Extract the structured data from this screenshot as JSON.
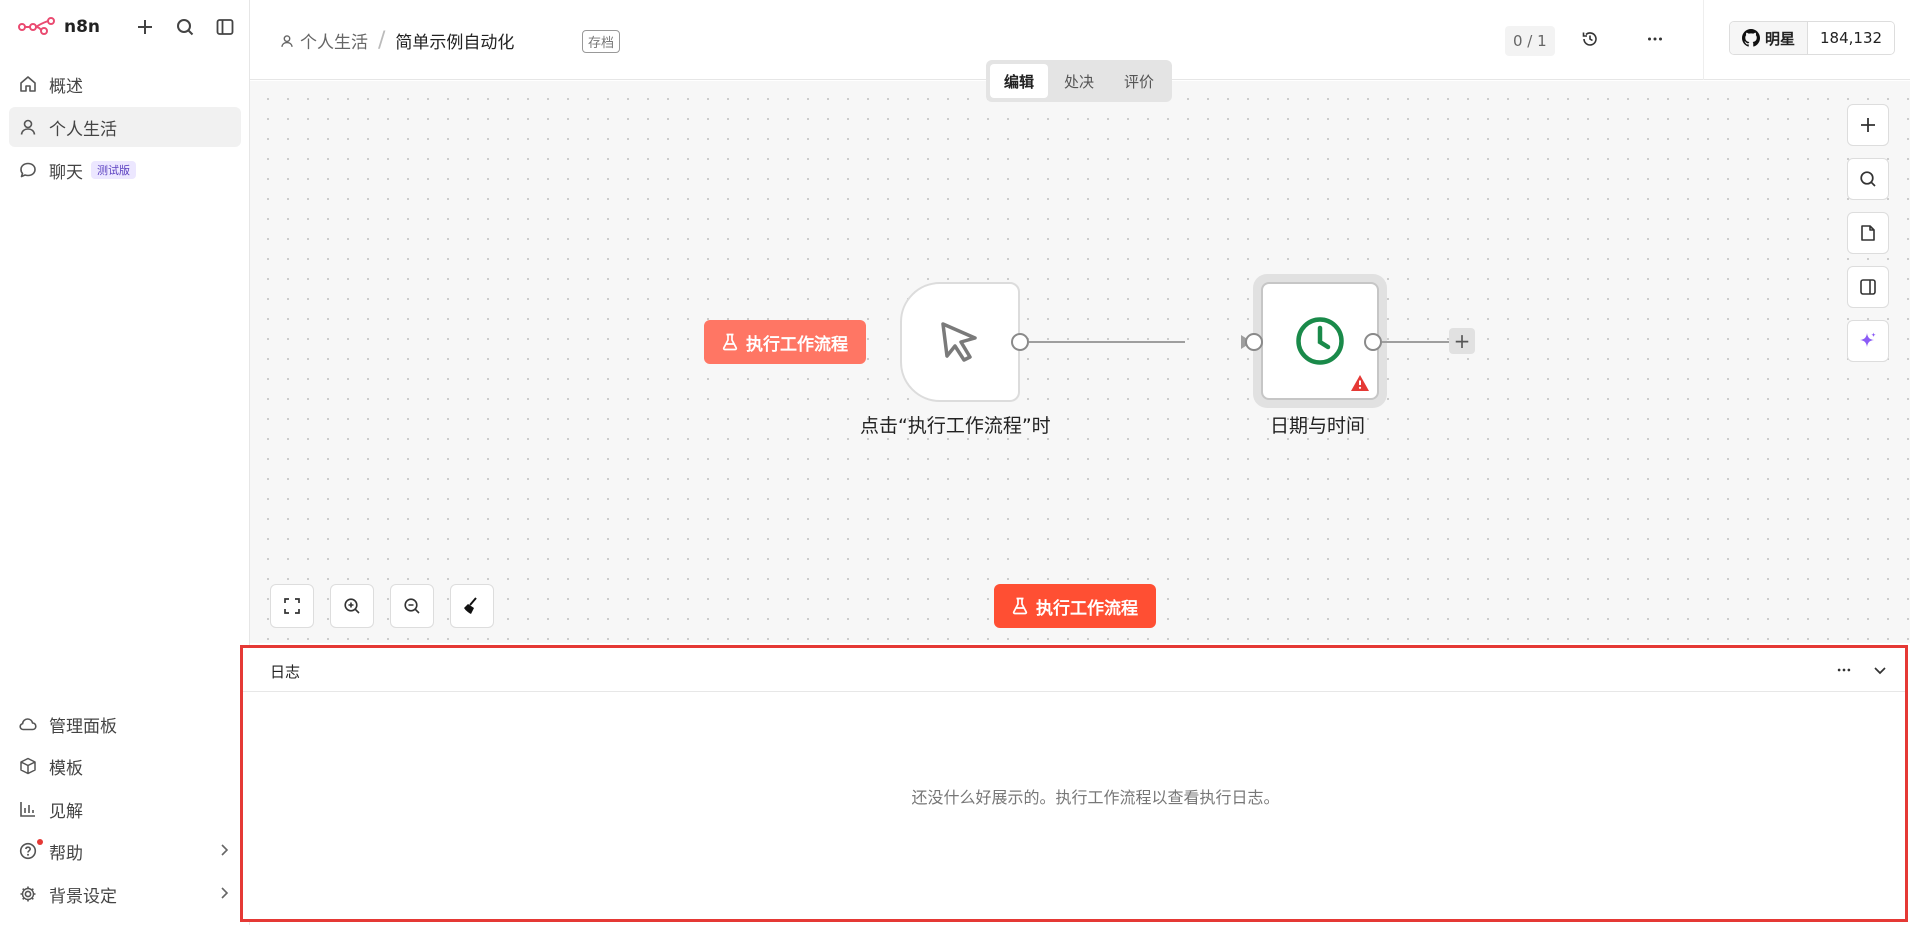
{
  "brand": {
    "name": "n8n"
  },
  "sidebar": {
    "top_items": [
      {
        "label": "概述",
        "icon": "home-icon"
      },
      {
        "label": "个人生活",
        "icon": "user-icon"
      },
      {
        "label": "聊天",
        "icon": "chat-icon",
        "badge": "测试版"
      }
    ],
    "bottom_items": [
      {
        "label": "管理面板",
        "icon": "cloud-icon"
      },
      {
        "label": "模板",
        "icon": "box-icon"
      },
      {
        "label": "见解",
        "icon": "bar-chart-icon"
      },
      {
        "label": "帮助",
        "icon": "help-icon"
      },
      {
        "label": "背景设定",
        "icon": "gear-icon"
      }
    ]
  },
  "header": {
    "breadcrumb_parent": "个人生活",
    "breadcrumb_separator": "/",
    "workflow_name": "简单示例自动化",
    "archived_tag": "存档",
    "counter": "0 / 1",
    "star_label": "明星",
    "star_count": "184,132"
  },
  "canvas": {
    "tabs": [
      "编辑",
      "处决",
      "评价"
    ],
    "active_tab": "编辑",
    "execute_label": "执行工作流程",
    "nodes": {
      "trigger_label": "点击“执行工作流程”时",
      "datetime_label": "日期与时间"
    },
    "add_symbol": "+"
  },
  "logs": {
    "title": "日志",
    "empty_message": "还没什么好展示的。执行工作流程以查看执行日志。"
  },
  "colors": {
    "accent": "#ff4f33",
    "accent_light": "#ff7664",
    "node_icon_green": "#1a8a4a",
    "warning_red": "#e53935",
    "highlight_border": "#e53935"
  }
}
